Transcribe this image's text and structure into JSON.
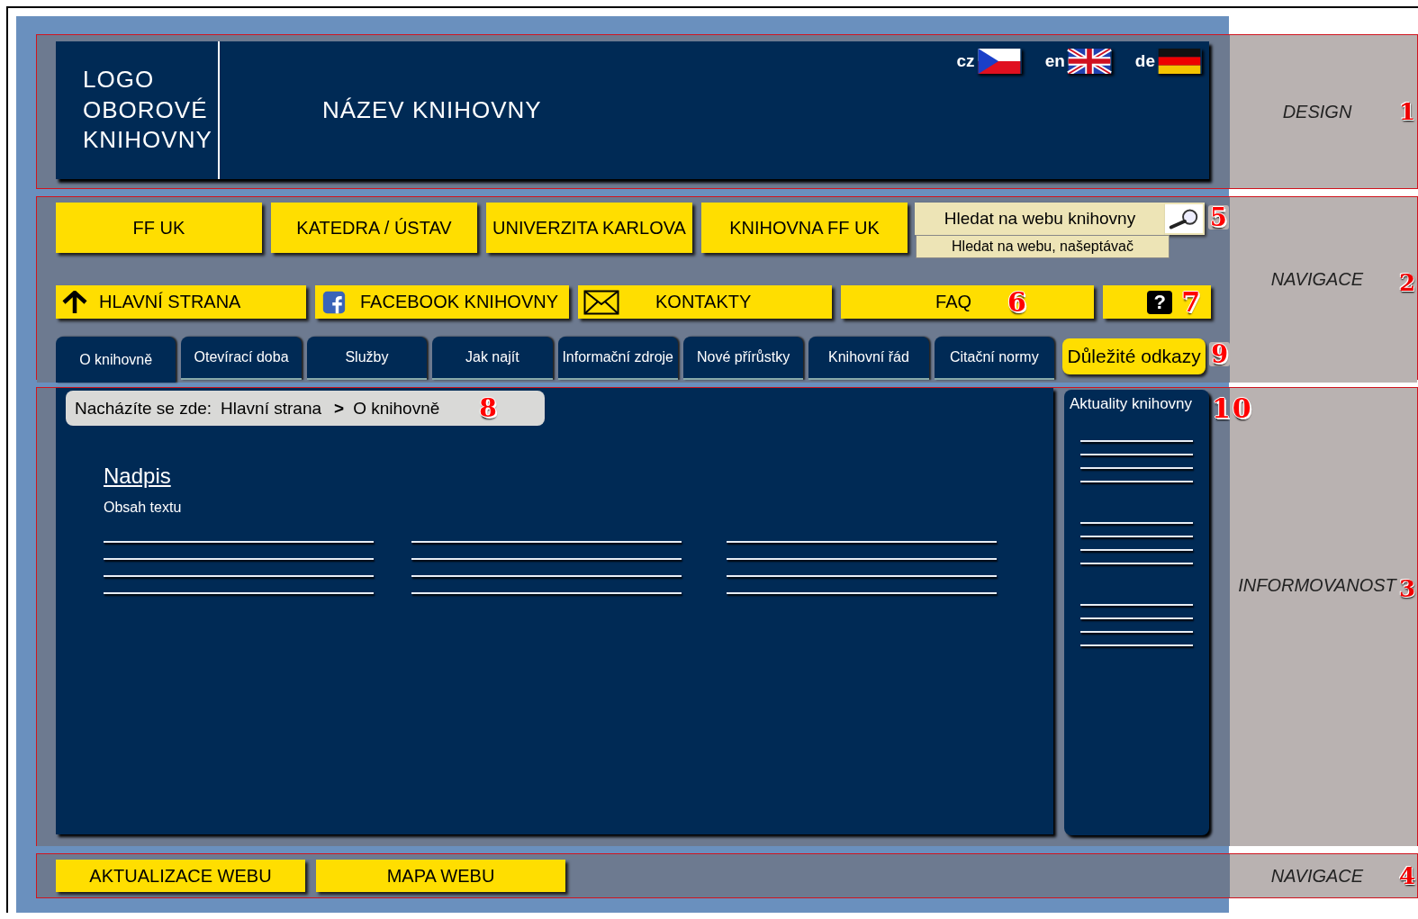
{
  "sections": [
    {
      "label": "DESIGN",
      "number": "1"
    },
    {
      "label": "NAVIGACE",
      "number": "2"
    },
    {
      "label": "INFORMOVANOST",
      "number": "3"
    },
    {
      "label": "NAVIGACE",
      "number": "4"
    }
  ],
  "header": {
    "logo": "LOGO OBOROVÉ KNIHOVNY",
    "title": "NÁZEV KNIHOVNY",
    "languages": [
      {
        "code": "cz",
        "kind": "cz"
      },
      {
        "code": "en",
        "kind": "gb"
      },
      {
        "code": "de",
        "kind": "de"
      }
    ]
  },
  "top_links": [
    "FF UK",
    "KATEDRA / ÚSTAV",
    "UNIVERZITA KARLOVA",
    "KNIHOVNA FF UK"
  ],
  "search": {
    "placeholder": "Hledat na webu knihovny",
    "suggestion": "Hledat na webu, našeptávač",
    "marker": "5"
  },
  "quick_links": [
    {
      "kind": "home",
      "label": "HLAVNÍ STRANA"
    },
    {
      "kind": "social",
      "label": "FACEBOOK KNIHOVNY"
    },
    {
      "kind": "mail",
      "label": "KONTAKTY"
    },
    {
      "kind": "plain",
      "label": "FAQ",
      "marker": "6"
    },
    {
      "kind": "help",
      "label": "?",
      "marker": "7"
    }
  ],
  "tabs": [
    {
      "label": "O knihovně",
      "selected": true
    },
    {
      "label": "Otevírací doba",
      "selected": false
    },
    {
      "label": "Služby",
      "selected": false
    },
    {
      "label": "Jak najít",
      "selected": false
    },
    {
      "label": "Informační zdroje",
      "selected": false
    },
    {
      "label": "Nové přírůstky",
      "selected": false
    },
    {
      "label": "Knihovní řád",
      "selected": false
    },
    {
      "label": "Citační normy",
      "selected": false
    }
  ],
  "important_links": {
    "label": "Důležité odkazy",
    "marker": "9"
  },
  "breadcrumb": {
    "prefix": "Nacházíte se zde:",
    "items": [
      "Hlavní strana",
      "O knihovně"
    ],
    "separator": ">",
    "marker": "8"
  },
  "content": {
    "heading": "Nadpis",
    "text": "Obsah textu"
  },
  "news": {
    "title": "Aktuality knihovny",
    "marker": "10"
  },
  "footer_links": [
    "AKTUALIZACE WEBU",
    "MAPA WEBU"
  ]
}
